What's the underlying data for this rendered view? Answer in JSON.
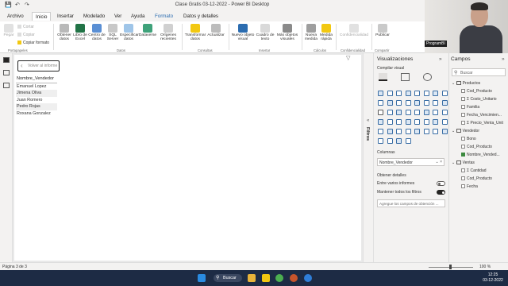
{
  "window": {
    "title": "Clase Gratis 03-12-2022 - Power BI Desktop"
  },
  "menu": {
    "tabs": [
      {
        "label": "Archivo",
        "active": false
      },
      {
        "label": "Inicio",
        "active": true
      },
      {
        "label": "Insertar",
        "active": false
      },
      {
        "label": "Modelado",
        "active": false
      },
      {
        "label": "Ver",
        "active": false
      },
      {
        "label": "Ayuda",
        "active": false
      },
      {
        "label": "Formato",
        "active": false
      },
      {
        "label": "Datos y detalles",
        "active": false
      }
    ]
  },
  "ribbon": {
    "clipboard": {
      "paste": "Pegar",
      "cut": "Cortar",
      "copy": "Copiar",
      "format_painter": "Copiar formato",
      "group": "Portapapeles"
    },
    "data": {
      "get_data": "Obtener datos",
      "excel": "Libro de Excel",
      "datahub": "Centro de datos",
      "sql": "SQL Server",
      "enter_data": "Especificar datos",
      "dataverse": "Dataverse",
      "recent": "Orígenes recientes",
      "group": "Datos"
    },
    "queries": {
      "transform": "Transformar datos",
      "refresh": "Actualizar",
      "group": "Consultas"
    },
    "insert": {
      "new_visual": "Nuevo objeto visual",
      "textbox": "Cuadro de texto",
      "more_visuals": "Más objetos visuales",
      "group": "Insertar"
    },
    "calculations": {
      "new_measure": "Nueva medida",
      "quick_measure": "Medida rápida",
      "group": "Cálculos"
    },
    "sensitivity": {
      "label": "Confidencialidad",
      "group": "Confidencialidad"
    },
    "share": {
      "publish": "Publicar",
      "group": "Compartir"
    }
  },
  "canvas": {
    "back_button": "Volver al informe",
    "table": {
      "header": "Nombre_Vendedor",
      "rows": [
        "Emanuel Lopez",
        "Jimena Oliva",
        "Juan Romero",
        "Pedro Rojas",
        "Roxana Gonzalez"
      ]
    }
  },
  "filters": {
    "label": "Filtros"
  },
  "visualizations": {
    "title": "Visualizaciones",
    "build_label": "Compilar visual",
    "columns_label": "Columnas",
    "column_field": "Nombre_Vendedor",
    "drillthrough_label": "Obtener detalles",
    "cross_report": {
      "label": "Entre varios informes",
      "on": false
    },
    "keep_filters": {
      "label": "Mantener todos los filtros",
      "on": true
    },
    "add_fields": "Agregue los campos de obtención ..."
  },
  "fields": {
    "title": "Campos",
    "search_placeholder": "Buscar",
    "tables": [
      {
        "name": "Productos",
        "items": [
          {
            "name": "Cod_Producto",
            "checked": false,
            "sigma": false
          },
          {
            "name": "Costo_Unitario",
            "checked": false,
            "sigma": true
          },
          {
            "name": "Familia",
            "checked": false,
            "sigma": false
          },
          {
            "name": "Fecha_Vencimien...",
            "checked": false,
            "sigma": false
          },
          {
            "name": "Precio_Venta_Unit",
            "checked": false,
            "sigma": true
          }
        ]
      },
      {
        "name": "Vendedor",
        "items": [
          {
            "name": "Bono",
            "checked": false,
            "sigma": false
          },
          {
            "name": "Cod_Producto",
            "checked": false,
            "sigma": false
          },
          {
            "name": "Nombre_Vended...",
            "checked": true,
            "sigma": false
          }
        ]
      },
      {
        "name": "Ventas",
        "items": [
          {
            "name": "Cantidad",
            "checked": false,
            "sigma": true
          },
          {
            "name": "Cod_Producto",
            "checked": false,
            "sigma": false
          },
          {
            "name": "Fecha",
            "checked": false,
            "sigma": false
          }
        ]
      }
    ]
  },
  "webcam": {
    "label": "ProgramBI"
  },
  "status": {
    "page": "Página 3 de 3",
    "zoom": "100 %"
  },
  "taskbar": {
    "search": "Buscar",
    "time": "12:25",
    "date": "03-12-2022"
  },
  "colors": {
    "accent": "#f2c811",
    "taskbar": "#1d2b44",
    "checked": "#3c8a3f"
  }
}
